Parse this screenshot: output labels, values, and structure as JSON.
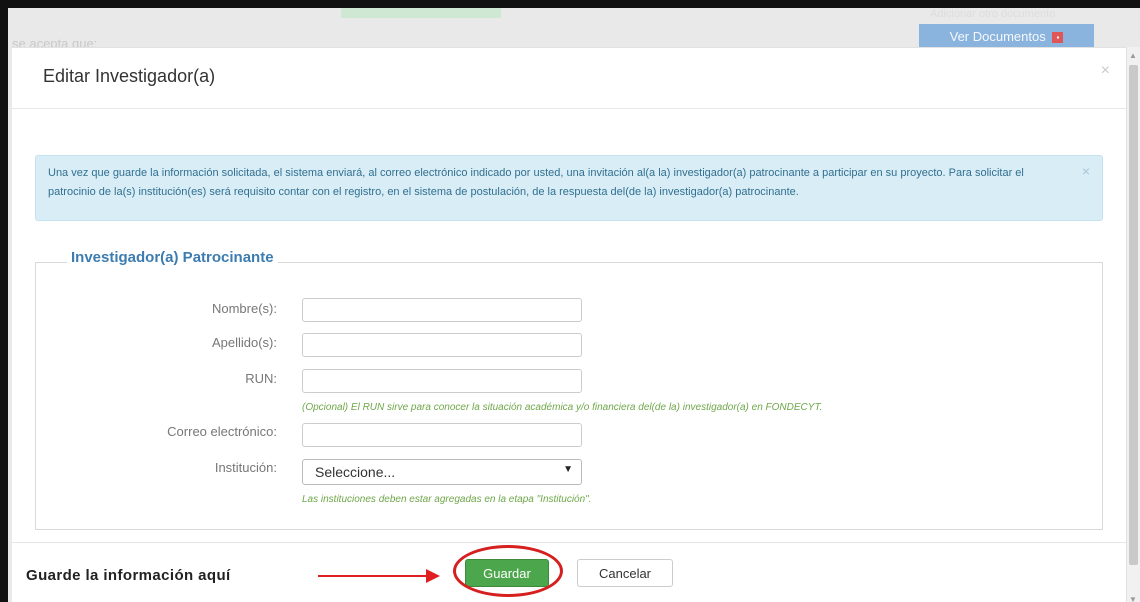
{
  "background": {
    "text": "se acepta que:",
    "ver_documentos": "Ver Documentos",
    "pdf_icon_label": "PDF",
    "faint_text": "Adicionar otro documento"
  },
  "modal": {
    "title": "Editar Investigador(a)",
    "close": "×",
    "alert": {
      "text": "Una vez que guarde la información solicitada, el sistema enviará, al correo electrónico indicado por usted, una invitación al(a la) investigador(a) patrocinante a participar en su proyecto. Para solicitar el patrocinio de la(s) institución(es) será requisito contar con el registro, en el sistema de postulación, de la respuesta del(de la) investigador(a) patrocinante.",
      "close": "×"
    },
    "fieldset": {
      "legend": "Investigador(a) Patrocinante",
      "fields": {
        "nombre": {
          "label": "Nombre(s):",
          "value": ""
        },
        "apellido": {
          "label": "Apellido(s):",
          "value": ""
        },
        "run": {
          "label": "RUN:",
          "value": "",
          "help": "(Opcional) El RUN sirve para conocer la situación académica y/o financiera del(de la) investigador(a) en FONDECYT."
        },
        "correo": {
          "label": "Correo electrónico:",
          "value": ""
        },
        "institucion": {
          "label": "Institución:",
          "selected": "Seleccione...",
          "caret": "▼",
          "help": "Las instituciones deben estar agregadas en la etapa \"Institución\"."
        }
      }
    },
    "footer": {
      "note": "Guarde la información aquí",
      "save_label": "Guardar",
      "cancel_label": "Cancelar"
    }
  },
  "colors": {
    "accent": "#3c7cb0",
    "save_button": "#4ca64c",
    "annotation": "#d61f1f",
    "help_text": "#6fa74a"
  },
  "icons": [
    "close-icon",
    "pdf-icon",
    "caret-down-icon",
    "arrow-right-icon"
  ]
}
